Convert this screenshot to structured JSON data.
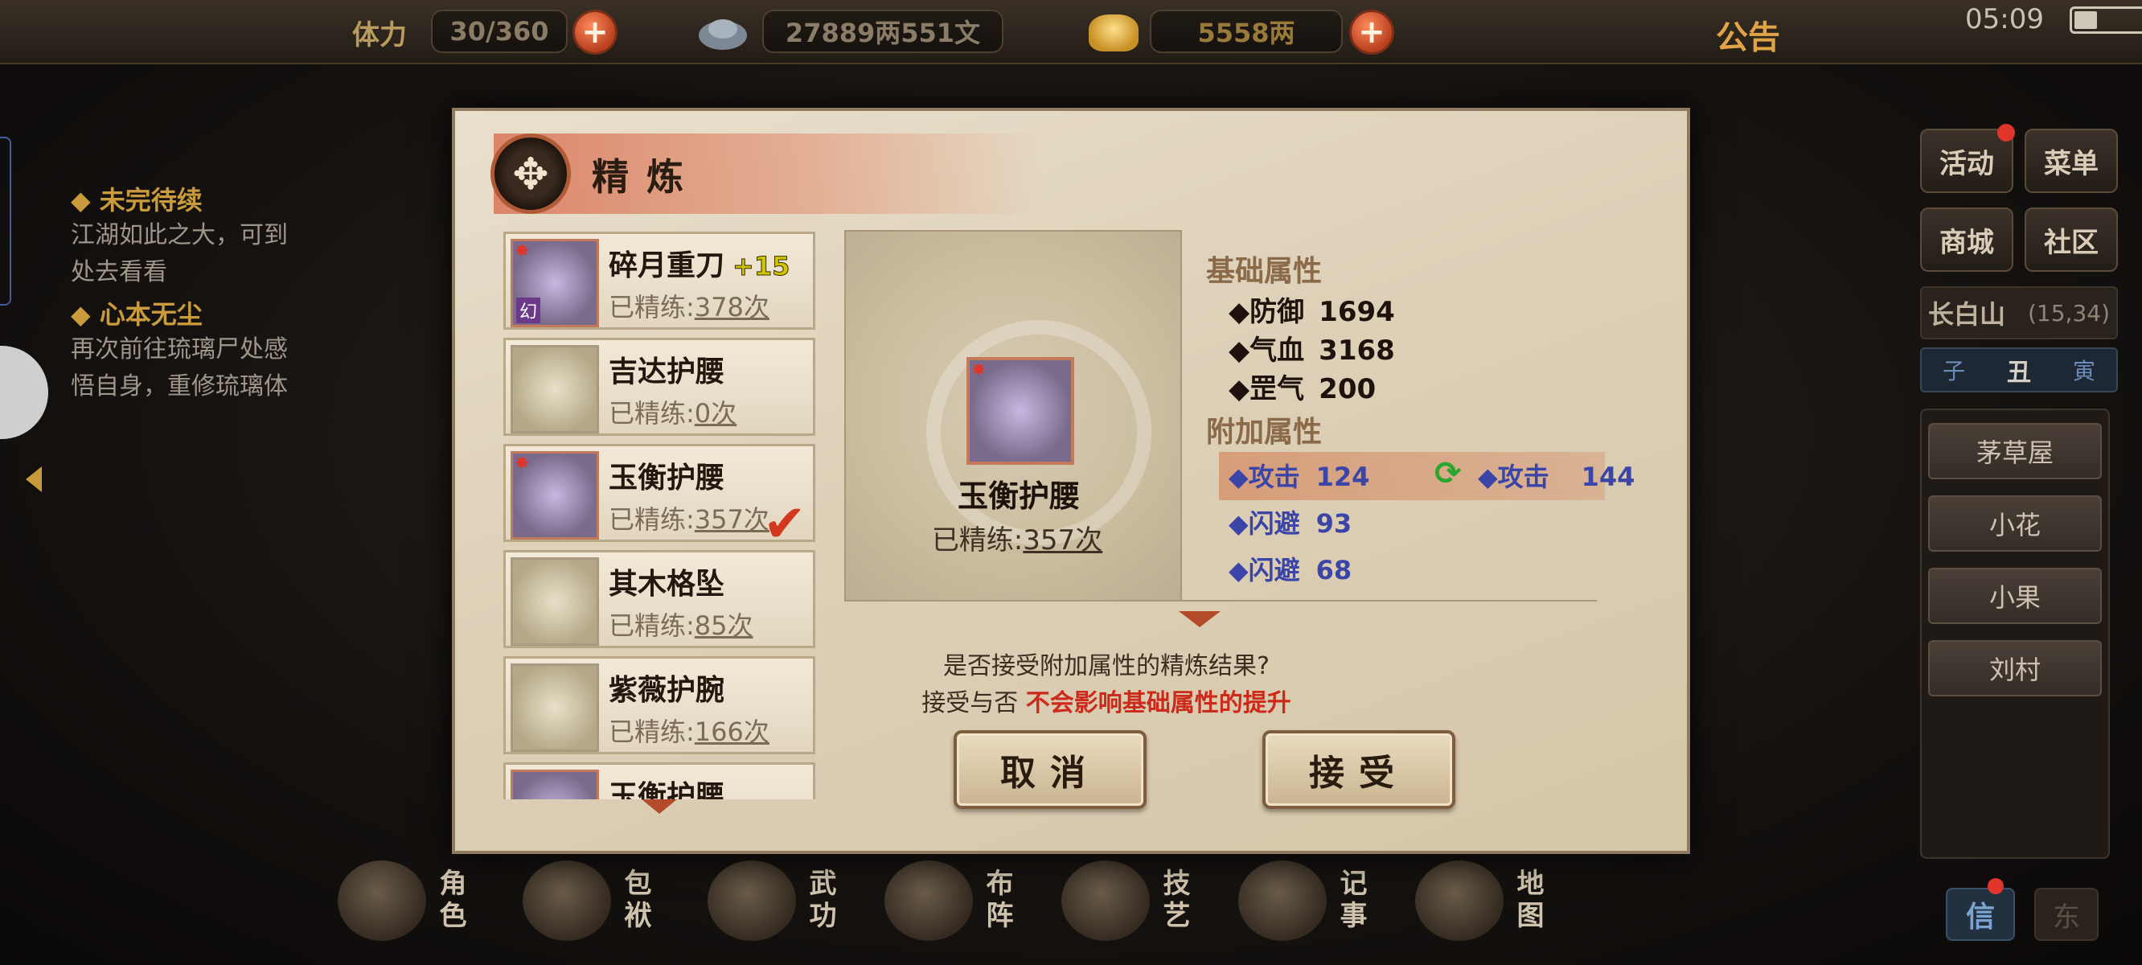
{
  "topbar": {
    "stamina_label": "体力",
    "stamina_value": "30/360",
    "silver_value": "27889两551文",
    "gold_value": "5558两",
    "notice_label": "公告",
    "clock": "05:09",
    "plus_glyph": "+"
  },
  "quests": [
    {
      "title": "未完待续",
      "text_lines": [
        "江湖如此之大，可到",
        "处去看看"
      ]
    },
    {
      "title": "心本无尘",
      "text_lines": [
        "再次前往琉璃尸处感",
        "悟自身，重修琉璃体"
      ]
    }
  ],
  "side": {
    "buttons": [
      "活动",
      "菜单",
      "商城",
      "社区"
    ],
    "location": "长白山",
    "coords": "(15,34)",
    "time_marks": [
      "子",
      "丑",
      "寅"
    ],
    "npcs": [
      "茅草屋",
      "小花",
      "小果",
      "刘村"
    ],
    "bottom_btn_1": "信",
    "bottom_btn_2": "东"
  },
  "bottom_menu": [
    {
      "label": "角色",
      "icon": "character-icon"
    },
    {
      "label": "包袱",
      "icon": "bag-icon"
    },
    {
      "label": "武功",
      "icon": "martial-arts-icon"
    },
    {
      "label": "布阵",
      "icon": "formation-icon"
    },
    {
      "label": "技艺",
      "icon": "craft-icon"
    },
    {
      "label": "记事",
      "icon": "journal-icon"
    },
    {
      "label": "地图",
      "icon": "map-icon"
    }
  ],
  "dialog": {
    "title": "精炼",
    "emblem_glyph": "✥",
    "items": [
      {
        "name": "碎月重刀",
        "plus": "+15",
        "count_prefix": "已精练:",
        "count": "378次",
        "tag": "幻",
        "style": "purple",
        "checked": false
      },
      {
        "name": "吉达护腰",
        "plus": "",
        "count_prefix": "已精练:",
        "count": "0次",
        "tag": "",
        "style": "plain",
        "checked": false
      },
      {
        "name": "玉衡护腰",
        "plus": "",
        "count_prefix": "已精练:",
        "count": "357次",
        "tag": "",
        "style": "purple",
        "checked": true
      },
      {
        "name": "其木格坠",
        "plus": "",
        "count_prefix": "已精练:",
        "count": "85次",
        "tag": "",
        "style": "plain",
        "checked": false
      },
      {
        "name": "紫薇护腕",
        "plus": "",
        "count_prefix": "已精练:",
        "count": "166次",
        "tag": "",
        "style": "plain",
        "checked": false
      },
      {
        "name": "玉衡护腰",
        "plus": "",
        "count_prefix": "",
        "count": "",
        "tag": "",
        "style": "purple",
        "checked": false
      }
    ],
    "check_glyph": "✔",
    "preview": {
      "name": "玉衡护腰",
      "count_prefix": "已精练:",
      "count": "357次"
    },
    "base_title": "基础属性",
    "base_attrs": [
      {
        "name": "防御",
        "value": "1694"
      },
      {
        "name": "气血",
        "value": "3168"
      },
      {
        "name": "罡气",
        "value": "200"
      }
    ],
    "bonus_title": "附加属性",
    "bonus_attrs": [
      {
        "name": "攻击",
        "value": "124"
      },
      {
        "name": "闪避",
        "value": "93"
      },
      {
        "name": "闪避",
        "value": "68"
      }
    ],
    "new_attr": {
      "name": "攻击",
      "value": "144"
    },
    "swap_glyph": "⟳",
    "prompt_line1": "是否接受附加属性的精炼结果?",
    "prompt_line2_prefix": "接受与否",
    "prompt_line2_red": "不会影响基础属性的提升",
    "cancel_label": "取消",
    "accept_label": "接受"
  },
  "colors": {
    "highlight": "#d69a76",
    "bonus_text": "#3b45a8",
    "accent_red": "#cc2a1b",
    "panel_bg": "#e9dfcc"
  }
}
